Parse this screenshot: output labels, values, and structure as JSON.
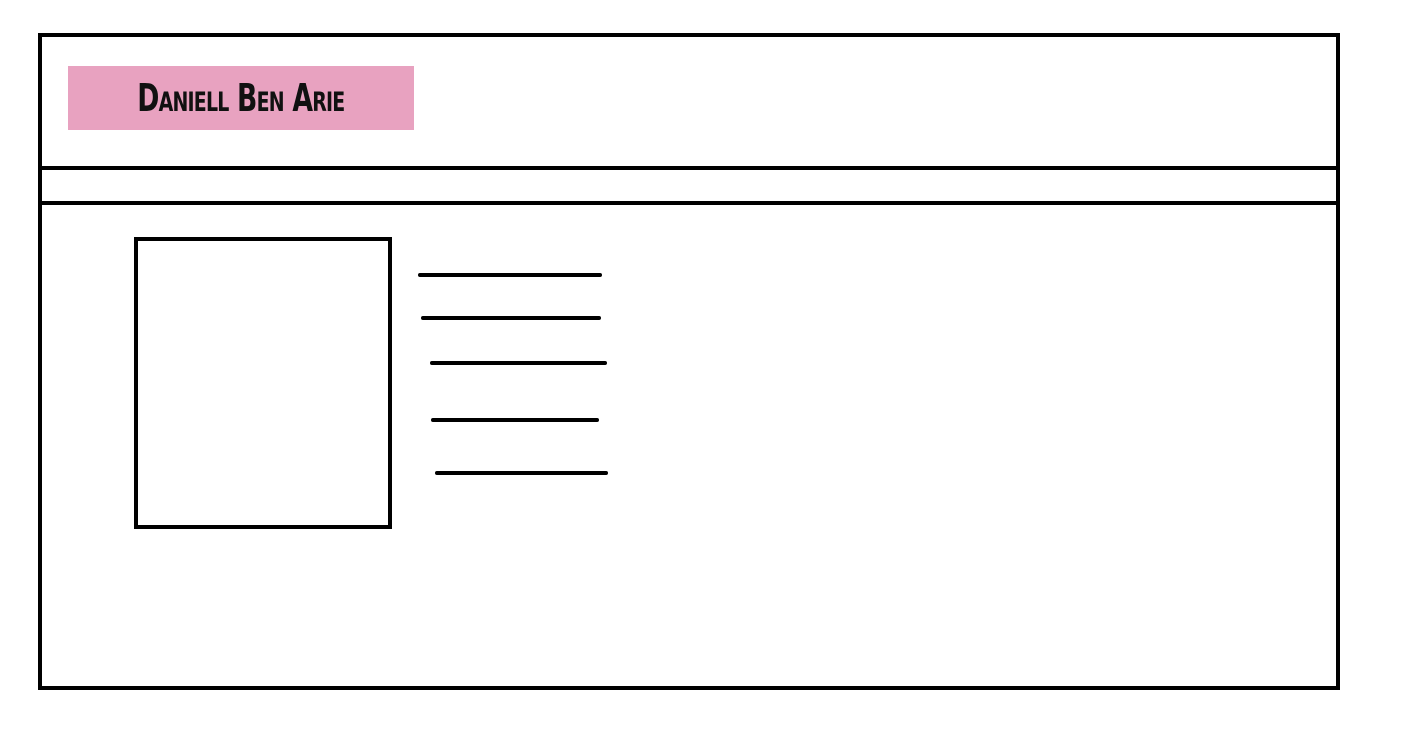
{
  "header": {
    "logo_text": "Daniell Ben Arie",
    "logo_color": "#e8a2c0"
  },
  "content": {
    "placeholder_lines": 5
  }
}
